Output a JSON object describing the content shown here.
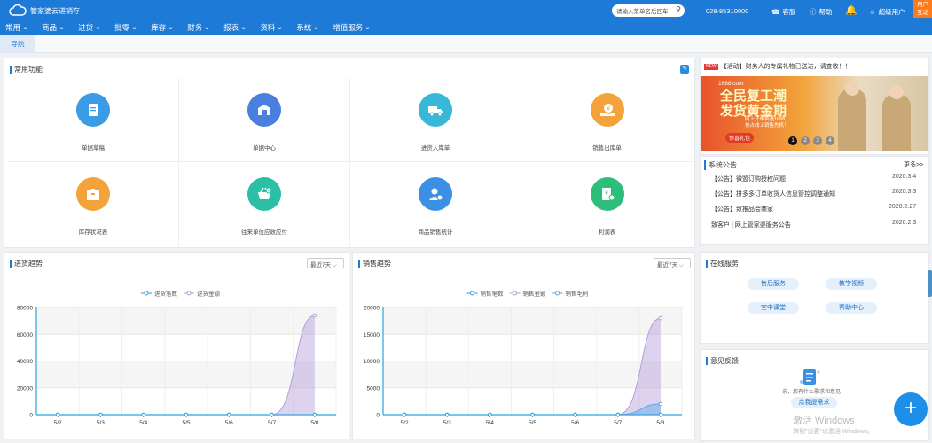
{
  "app": {
    "title": "管家婆云进销存"
  },
  "menu": [
    {
      "label": "常用"
    },
    {
      "label": "商品"
    },
    {
      "label": "进货"
    },
    {
      "label": "批零"
    },
    {
      "label": "库存"
    },
    {
      "label": "财务"
    },
    {
      "label": "报表"
    },
    {
      "label": "资料"
    },
    {
      "label": "系统"
    },
    {
      "label": "增值服务"
    }
  ],
  "header": {
    "search_placeholder": "请输入菜单名后回车",
    "phone": "028-85310000",
    "service": "客服",
    "help": "帮助",
    "user": "超级用户",
    "corner_badge": "用户互动"
  },
  "nav": {
    "tab": "导航"
  },
  "common": {
    "title": "常用功能",
    "items": [
      {
        "label": "单据草稿",
        "color": "#3b9be4",
        "icon": "document-icon"
      },
      {
        "label": "单据中心",
        "color": "#4a7fe0",
        "icon": "store-icon"
      },
      {
        "label": "进货入库单",
        "color": "#38b8d8",
        "icon": "truck-icon"
      },
      {
        "label": "销售出库单",
        "color": "#f4a23a",
        "icon": "money-hand-icon"
      },
      {
        "label": "库存状况表",
        "color": "#f4a23a",
        "icon": "box-icon"
      },
      {
        "label": "往来单位应收应付",
        "color": "#2bbfa6",
        "icon": "basket-icon"
      },
      {
        "label": "商品销售统计",
        "color": "#3b8fe4",
        "icon": "user-stats-icon"
      },
      {
        "label": "利润表",
        "color": "#2bbf7a",
        "icon": "profit-icon"
      }
    ]
  },
  "promo": {
    "new_tag": "NEW",
    "text": "【活动】财务人的专属礼物已送达，请查收！！",
    "banner_site": "1688.com",
    "banner_title_1": "全民复工潮",
    "banner_title_2": "发货黄金期",
    "banner_sub_1": "网上开单首选1688,",
    "banner_sub_2": "抢占线上销售先机！",
    "banner_btn": "惊喜礼包",
    "dots": [
      "1",
      "2",
      "3",
      "4"
    ]
  },
  "notices": {
    "title": "系统公告",
    "more": "更多>>",
    "items": [
      {
        "text": "【公告】微盟订购授权问题",
        "date": "2020.3.4"
      },
      {
        "text": "【公告】拼多多订单收货人信息管控调整通知",
        "date": "2020.3.3"
      },
      {
        "text": "【公告】致推品会商家",
        "date": "2020.2.27"
      },
      {
        "text": "致客户 | 网上管家婆服务公告",
        "date": "2020.2.3"
      }
    ]
  },
  "purchase": {
    "title": "进货趋势",
    "range": "最近7天"
  },
  "sales": {
    "title": "销售趋势",
    "range": "最近7天"
  },
  "online": {
    "title": "在线服务",
    "buttons": [
      "售后服务",
      "教学视频",
      "空中课堂",
      "帮助中心"
    ]
  },
  "feedback": {
    "title": "意见反馈",
    "text": "亲，您有什么需求和意见",
    "button": "点我提需求"
  },
  "watermark": {
    "line1": "激活 Windows",
    "line2": "转到\"设置\"以激活 Windows。"
  },
  "chart_data": [
    {
      "type": "area",
      "title": "进货趋势",
      "categories": [
        "5/2",
        "5/3",
        "5/4",
        "5/5",
        "5/6",
        "5/7",
        "5/8"
      ],
      "ylim": [
        0,
        80000
      ],
      "yticks": [
        0,
        20000,
        40000,
        60000,
        80000
      ],
      "series": [
        {
          "name": "进货笔数",
          "values": [
            0,
            0,
            0,
            0,
            0,
            0,
            0
          ],
          "color": "#27a4dc"
        },
        {
          "name": "进货金额",
          "values": [
            0,
            0,
            0,
            0,
            0,
            0,
            74000
          ],
          "color": "#b39ddb"
        }
      ]
    },
    {
      "type": "area",
      "title": "销售趋势",
      "categories": [
        "5/2",
        "5/3",
        "5/4",
        "5/5",
        "5/6",
        "5/7",
        "5/8"
      ],
      "ylim": [
        0,
        20000
      ],
      "yticks": [
        0,
        5000,
        10000,
        15000,
        20000
      ],
      "series": [
        {
          "name": "销售笔数",
          "values": [
            0,
            0,
            0,
            0,
            0,
            0,
            0
          ],
          "color": "#27a4dc"
        },
        {
          "name": "销售金额",
          "values": [
            0,
            0,
            0,
            0,
            0,
            0,
            18000
          ],
          "color": "#b39ddb"
        },
        {
          "name": "销售毛利",
          "values": [
            0,
            0,
            0,
            0,
            0,
            0,
            2000
          ],
          "color": "#5aa8e8"
        }
      ]
    }
  ]
}
